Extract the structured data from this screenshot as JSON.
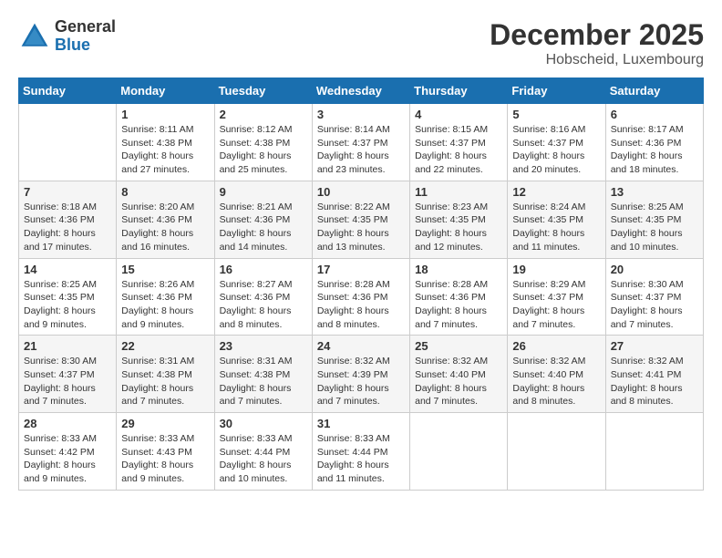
{
  "header": {
    "logo_general": "General",
    "logo_blue": "Blue",
    "month_year": "December 2025",
    "location": "Hobscheid, Luxembourg"
  },
  "weekdays": [
    "Sunday",
    "Monday",
    "Tuesday",
    "Wednesday",
    "Thursday",
    "Friday",
    "Saturday"
  ],
  "weeks": [
    [
      {
        "day": "",
        "sunrise": "",
        "sunset": "",
        "daylight": ""
      },
      {
        "day": "1",
        "sunrise": "Sunrise: 8:11 AM",
        "sunset": "Sunset: 4:38 PM",
        "daylight": "Daylight: 8 hours and 27 minutes."
      },
      {
        "day": "2",
        "sunrise": "Sunrise: 8:12 AM",
        "sunset": "Sunset: 4:38 PM",
        "daylight": "Daylight: 8 hours and 25 minutes."
      },
      {
        "day": "3",
        "sunrise": "Sunrise: 8:14 AM",
        "sunset": "Sunset: 4:37 PM",
        "daylight": "Daylight: 8 hours and 23 minutes."
      },
      {
        "day": "4",
        "sunrise": "Sunrise: 8:15 AM",
        "sunset": "Sunset: 4:37 PM",
        "daylight": "Daylight: 8 hours and 22 minutes."
      },
      {
        "day": "5",
        "sunrise": "Sunrise: 8:16 AM",
        "sunset": "Sunset: 4:37 PM",
        "daylight": "Daylight: 8 hours and 20 minutes."
      },
      {
        "day": "6",
        "sunrise": "Sunrise: 8:17 AM",
        "sunset": "Sunset: 4:36 PM",
        "daylight": "Daylight: 8 hours and 18 minutes."
      }
    ],
    [
      {
        "day": "7",
        "sunrise": "Sunrise: 8:18 AM",
        "sunset": "Sunset: 4:36 PM",
        "daylight": "Daylight: 8 hours and 17 minutes."
      },
      {
        "day": "8",
        "sunrise": "Sunrise: 8:20 AM",
        "sunset": "Sunset: 4:36 PM",
        "daylight": "Daylight: 8 hours and 16 minutes."
      },
      {
        "day": "9",
        "sunrise": "Sunrise: 8:21 AM",
        "sunset": "Sunset: 4:36 PM",
        "daylight": "Daylight: 8 hours and 14 minutes."
      },
      {
        "day": "10",
        "sunrise": "Sunrise: 8:22 AM",
        "sunset": "Sunset: 4:35 PM",
        "daylight": "Daylight: 8 hours and 13 minutes."
      },
      {
        "day": "11",
        "sunrise": "Sunrise: 8:23 AM",
        "sunset": "Sunset: 4:35 PM",
        "daylight": "Daylight: 8 hours and 12 minutes."
      },
      {
        "day": "12",
        "sunrise": "Sunrise: 8:24 AM",
        "sunset": "Sunset: 4:35 PM",
        "daylight": "Daylight: 8 hours and 11 minutes."
      },
      {
        "day": "13",
        "sunrise": "Sunrise: 8:25 AM",
        "sunset": "Sunset: 4:35 PM",
        "daylight": "Daylight: 8 hours and 10 minutes."
      }
    ],
    [
      {
        "day": "14",
        "sunrise": "Sunrise: 8:25 AM",
        "sunset": "Sunset: 4:35 PM",
        "daylight": "Daylight: 8 hours and 9 minutes."
      },
      {
        "day": "15",
        "sunrise": "Sunrise: 8:26 AM",
        "sunset": "Sunset: 4:36 PM",
        "daylight": "Daylight: 8 hours and 9 minutes."
      },
      {
        "day": "16",
        "sunrise": "Sunrise: 8:27 AM",
        "sunset": "Sunset: 4:36 PM",
        "daylight": "Daylight: 8 hours and 8 minutes."
      },
      {
        "day": "17",
        "sunrise": "Sunrise: 8:28 AM",
        "sunset": "Sunset: 4:36 PM",
        "daylight": "Daylight: 8 hours and 8 minutes."
      },
      {
        "day": "18",
        "sunrise": "Sunrise: 8:28 AM",
        "sunset": "Sunset: 4:36 PM",
        "daylight": "Daylight: 8 hours and 7 minutes."
      },
      {
        "day": "19",
        "sunrise": "Sunrise: 8:29 AM",
        "sunset": "Sunset: 4:37 PM",
        "daylight": "Daylight: 8 hours and 7 minutes."
      },
      {
        "day": "20",
        "sunrise": "Sunrise: 8:30 AM",
        "sunset": "Sunset: 4:37 PM",
        "daylight": "Daylight: 8 hours and 7 minutes."
      }
    ],
    [
      {
        "day": "21",
        "sunrise": "Sunrise: 8:30 AM",
        "sunset": "Sunset: 4:37 PM",
        "daylight": "Daylight: 8 hours and 7 minutes."
      },
      {
        "day": "22",
        "sunrise": "Sunrise: 8:31 AM",
        "sunset": "Sunset: 4:38 PM",
        "daylight": "Daylight: 8 hours and 7 minutes."
      },
      {
        "day": "23",
        "sunrise": "Sunrise: 8:31 AM",
        "sunset": "Sunset: 4:38 PM",
        "daylight": "Daylight: 8 hours and 7 minutes."
      },
      {
        "day": "24",
        "sunrise": "Sunrise: 8:32 AM",
        "sunset": "Sunset: 4:39 PM",
        "daylight": "Daylight: 8 hours and 7 minutes."
      },
      {
        "day": "25",
        "sunrise": "Sunrise: 8:32 AM",
        "sunset": "Sunset: 4:40 PM",
        "daylight": "Daylight: 8 hours and 7 minutes."
      },
      {
        "day": "26",
        "sunrise": "Sunrise: 8:32 AM",
        "sunset": "Sunset: 4:40 PM",
        "daylight": "Daylight: 8 hours and 8 minutes."
      },
      {
        "day": "27",
        "sunrise": "Sunrise: 8:32 AM",
        "sunset": "Sunset: 4:41 PM",
        "daylight": "Daylight: 8 hours and 8 minutes."
      }
    ],
    [
      {
        "day": "28",
        "sunrise": "Sunrise: 8:33 AM",
        "sunset": "Sunset: 4:42 PM",
        "daylight": "Daylight: 8 hours and 9 minutes."
      },
      {
        "day": "29",
        "sunrise": "Sunrise: 8:33 AM",
        "sunset": "Sunset: 4:43 PM",
        "daylight": "Daylight: 8 hours and 9 minutes."
      },
      {
        "day": "30",
        "sunrise": "Sunrise: 8:33 AM",
        "sunset": "Sunset: 4:44 PM",
        "daylight": "Daylight: 8 hours and 10 minutes."
      },
      {
        "day": "31",
        "sunrise": "Sunrise: 8:33 AM",
        "sunset": "Sunset: 4:44 PM",
        "daylight": "Daylight: 8 hours and 11 minutes."
      },
      {
        "day": "",
        "sunrise": "",
        "sunset": "",
        "daylight": ""
      },
      {
        "day": "",
        "sunrise": "",
        "sunset": "",
        "daylight": ""
      },
      {
        "day": "",
        "sunrise": "",
        "sunset": "",
        "daylight": ""
      }
    ]
  ]
}
